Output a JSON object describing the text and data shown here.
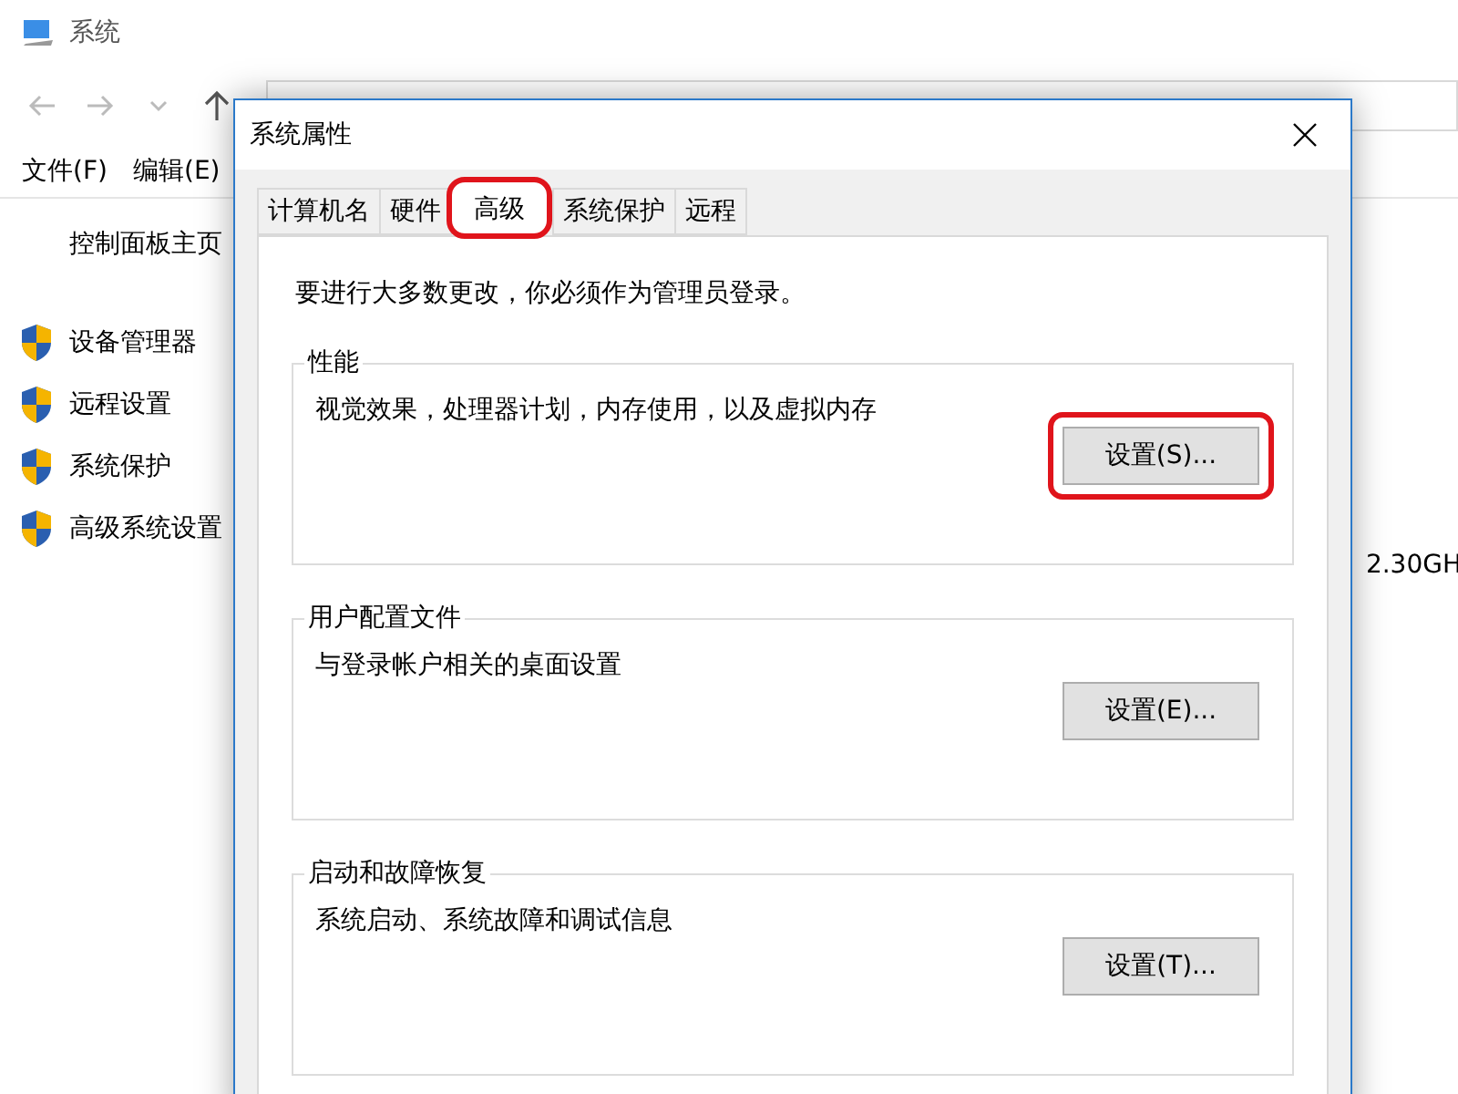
{
  "window": {
    "title": "系统"
  },
  "menu": [
    "文件(F)",
    "编辑(E)"
  ],
  "sidebar": {
    "home": "控制面板主页",
    "items": [
      "设备管理器",
      "远程设置",
      "系统保护",
      "高级系统设置"
    ]
  },
  "content": {
    "cpu_fragment": "2.30GH"
  },
  "dialog": {
    "title": "系统属性",
    "tabs": [
      {
        "label": "计算机名",
        "selected": false,
        "highlighted": false
      },
      {
        "label": "硬件",
        "selected": false,
        "highlighted": false
      },
      {
        "label": "高级",
        "selected": true,
        "highlighted": true
      },
      {
        "label": "系统保护",
        "selected": false,
        "highlighted": false
      },
      {
        "label": "远程",
        "selected": false,
        "highlighted": false
      }
    ],
    "notice": "要进行大多数更改，你必须作为管理员登录。",
    "groups": [
      {
        "title": "性能",
        "description": "视觉效果，处理器计划，内存使用，以及虚拟内存",
        "button": "设置(S)...",
        "highlighted": true
      },
      {
        "title": "用户配置文件",
        "description": "与登录帐户相关的桌面设置",
        "button": "设置(E)...",
        "highlighted": false
      },
      {
        "title": "启动和故障恢复",
        "description": "系统启动、系统故障和调试信息",
        "button": "设置(T)...",
        "highlighted": false
      }
    ]
  }
}
